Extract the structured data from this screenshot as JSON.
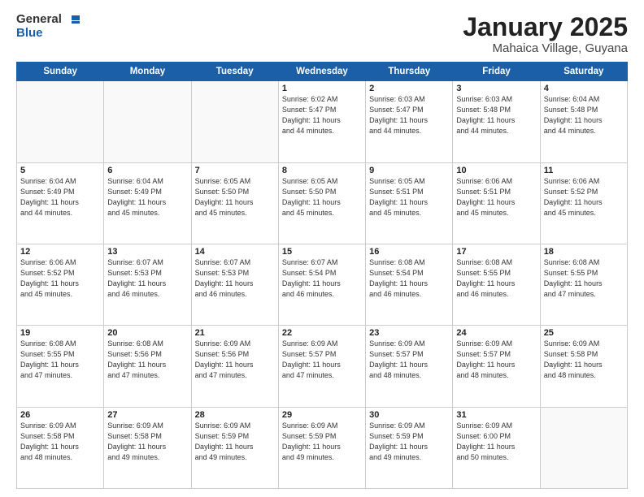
{
  "header": {
    "logo_general": "General",
    "logo_blue": "Blue",
    "month": "January 2025",
    "location": "Mahaica Village, Guyana"
  },
  "days_of_week": [
    "Sunday",
    "Monday",
    "Tuesday",
    "Wednesday",
    "Thursday",
    "Friday",
    "Saturday"
  ],
  "weeks": [
    [
      {
        "day": "",
        "info": ""
      },
      {
        "day": "",
        "info": ""
      },
      {
        "day": "",
        "info": ""
      },
      {
        "day": "1",
        "info": "Sunrise: 6:02 AM\nSunset: 5:47 PM\nDaylight: 11 hours\nand 44 minutes."
      },
      {
        "day": "2",
        "info": "Sunrise: 6:03 AM\nSunset: 5:47 PM\nDaylight: 11 hours\nand 44 minutes."
      },
      {
        "day": "3",
        "info": "Sunrise: 6:03 AM\nSunset: 5:48 PM\nDaylight: 11 hours\nand 44 minutes."
      },
      {
        "day": "4",
        "info": "Sunrise: 6:04 AM\nSunset: 5:48 PM\nDaylight: 11 hours\nand 44 minutes."
      }
    ],
    [
      {
        "day": "5",
        "info": "Sunrise: 6:04 AM\nSunset: 5:49 PM\nDaylight: 11 hours\nand 44 minutes."
      },
      {
        "day": "6",
        "info": "Sunrise: 6:04 AM\nSunset: 5:49 PM\nDaylight: 11 hours\nand 45 minutes."
      },
      {
        "day": "7",
        "info": "Sunrise: 6:05 AM\nSunset: 5:50 PM\nDaylight: 11 hours\nand 45 minutes."
      },
      {
        "day": "8",
        "info": "Sunrise: 6:05 AM\nSunset: 5:50 PM\nDaylight: 11 hours\nand 45 minutes."
      },
      {
        "day": "9",
        "info": "Sunrise: 6:05 AM\nSunset: 5:51 PM\nDaylight: 11 hours\nand 45 minutes."
      },
      {
        "day": "10",
        "info": "Sunrise: 6:06 AM\nSunset: 5:51 PM\nDaylight: 11 hours\nand 45 minutes."
      },
      {
        "day": "11",
        "info": "Sunrise: 6:06 AM\nSunset: 5:52 PM\nDaylight: 11 hours\nand 45 minutes."
      }
    ],
    [
      {
        "day": "12",
        "info": "Sunrise: 6:06 AM\nSunset: 5:52 PM\nDaylight: 11 hours\nand 45 minutes."
      },
      {
        "day": "13",
        "info": "Sunrise: 6:07 AM\nSunset: 5:53 PM\nDaylight: 11 hours\nand 46 minutes."
      },
      {
        "day": "14",
        "info": "Sunrise: 6:07 AM\nSunset: 5:53 PM\nDaylight: 11 hours\nand 46 minutes."
      },
      {
        "day": "15",
        "info": "Sunrise: 6:07 AM\nSunset: 5:54 PM\nDaylight: 11 hours\nand 46 minutes."
      },
      {
        "day": "16",
        "info": "Sunrise: 6:08 AM\nSunset: 5:54 PM\nDaylight: 11 hours\nand 46 minutes."
      },
      {
        "day": "17",
        "info": "Sunrise: 6:08 AM\nSunset: 5:55 PM\nDaylight: 11 hours\nand 46 minutes."
      },
      {
        "day": "18",
        "info": "Sunrise: 6:08 AM\nSunset: 5:55 PM\nDaylight: 11 hours\nand 47 minutes."
      }
    ],
    [
      {
        "day": "19",
        "info": "Sunrise: 6:08 AM\nSunset: 5:55 PM\nDaylight: 11 hours\nand 47 minutes."
      },
      {
        "day": "20",
        "info": "Sunrise: 6:08 AM\nSunset: 5:56 PM\nDaylight: 11 hours\nand 47 minutes."
      },
      {
        "day": "21",
        "info": "Sunrise: 6:09 AM\nSunset: 5:56 PM\nDaylight: 11 hours\nand 47 minutes."
      },
      {
        "day": "22",
        "info": "Sunrise: 6:09 AM\nSunset: 5:57 PM\nDaylight: 11 hours\nand 47 minutes."
      },
      {
        "day": "23",
        "info": "Sunrise: 6:09 AM\nSunset: 5:57 PM\nDaylight: 11 hours\nand 48 minutes."
      },
      {
        "day": "24",
        "info": "Sunrise: 6:09 AM\nSunset: 5:57 PM\nDaylight: 11 hours\nand 48 minutes."
      },
      {
        "day": "25",
        "info": "Sunrise: 6:09 AM\nSunset: 5:58 PM\nDaylight: 11 hours\nand 48 minutes."
      }
    ],
    [
      {
        "day": "26",
        "info": "Sunrise: 6:09 AM\nSunset: 5:58 PM\nDaylight: 11 hours\nand 48 minutes."
      },
      {
        "day": "27",
        "info": "Sunrise: 6:09 AM\nSunset: 5:58 PM\nDaylight: 11 hours\nand 49 minutes."
      },
      {
        "day": "28",
        "info": "Sunrise: 6:09 AM\nSunset: 5:59 PM\nDaylight: 11 hours\nand 49 minutes."
      },
      {
        "day": "29",
        "info": "Sunrise: 6:09 AM\nSunset: 5:59 PM\nDaylight: 11 hours\nand 49 minutes."
      },
      {
        "day": "30",
        "info": "Sunrise: 6:09 AM\nSunset: 5:59 PM\nDaylight: 11 hours\nand 49 minutes."
      },
      {
        "day": "31",
        "info": "Sunrise: 6:09 AM\nSunset: 6:00 PM\nDaylight: 11 hours\nand 50 minutes."
      },
      {
        "day": "",
        "info": ""
      }
    ]
  ]
}
